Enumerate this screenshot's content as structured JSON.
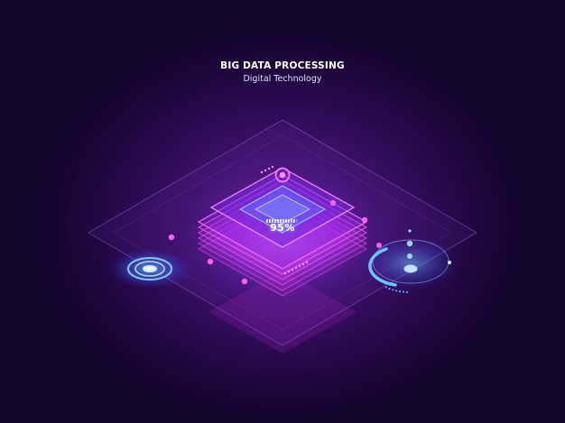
{
  "header": {
    "title": "BIG DATA PROCESSING",
    "subtitle": "Digital Technology"
  },
  "progress": {
    "label": "95%",
    "value": 0.95
  },
  "colors": {
    "background": "#230846",
    "plate_glow": "#e23cff",
    "cyan_accent": "#63b9ff",
    "node": "#ff5cf0"
  }
}
